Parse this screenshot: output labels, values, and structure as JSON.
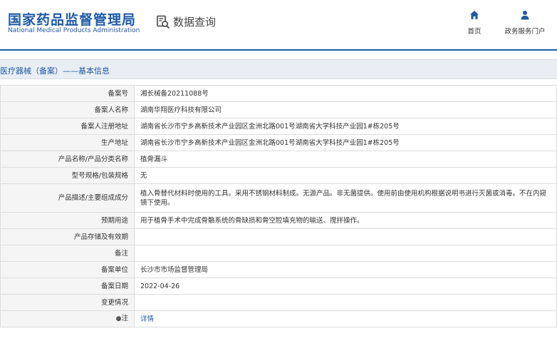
{
  "header": {
    "brand_cn": "国家药品监督管理局",
    "brand_en": "National Medical Products Administration",
    "query_label": "数据查询",
    "nav": [
      {
        "label": "首页",
        "icon": "home-icon"
      },
      {
        "label": "政务服务门户",
        "icon": "user-icon"
      }
    ]
  },
  "breadcrumb": "医疗器械（备案）——基本信息",
  "colors": {
    "brand": "#1f5aa6",
    "strip": "#e9eef4",
    "label_bg": "#f5f5f5",
    "border": "#dcdcdc"
  },
  "rows": [
    {
      "key": "备案号",
      "value": "湘长械备20211088号"
    },
    {
      "key": "备案人名称",
      "value": "湖南华翔医疗科技有限公司"
    },
    {
      "key": "备案人注册地址",
      "value": "湖南省长沙市宁乡高新技术产业园区金洲北路001号湖南省大学科技产业园1#栋205号"
    },
    {
      "key": "生产地址",
      "value": "湖南省长沙市宁乡高新技术产业园区金洲北路001号湖南省大学科技产业园1#栋205号"
    },
    {
      "key": "产品名称/产品分类名称",
      "value": "植骨漏斗"
    },
    {
      "key": "型号规格/包装规格",
      "value": "无"
    },
    {
      "key": "产品描述/主要组成成分",
      "value": "植入骨替代材料时使用的工具。采用不锈钢材料制成。无源产品。非无菌提供。使用前由使用机构根据说明书进行灭菌或消毒。不在内窥镜下使用。"
    },
    {
      "key": "预期用途",
      "value": "用于植骨手术中完成骨骼系统的骨缺损和骨空腔填充物的输送、搅拌操作。"
    },
    {
      "key": "产品存储及有效期",
      "value": ""
    },
    {
      "key": "备注",
      "value": ""
    },
    {
      "key": "备案单位",
      "value": "长沙市市场监督管理局"
    },
    {
      "key": "备案日期",
      "value": "2022-04-26"
    },
    {
      "key": "变更情况",
      "value": ""
    },
    {
      "key": "注",
      "value": "详情"
    }
  ]
}
